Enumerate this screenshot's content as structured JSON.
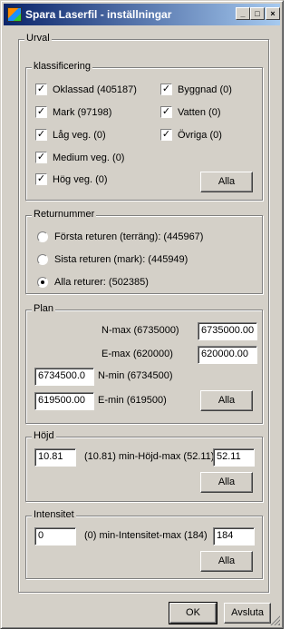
{
  "window": {
    "title": "Spara Laserfil - inställningar"
  },
  "caption_buttons": {
    "minimize": "_",
    "maximize": "□",
    "close": "×"
  },
  "urval": {
    "legend": "Urval",
    "klassificering": {
      "legend": "klassificering",
      "items": [
        {
          "label": "Oklassad (405187)",
          "checked": true
        },
        {
          "label": "Byggnad (0)",
          "checked": true
        },
        {
          "label": "Mark (97198)",
          "checked": true
        },
        {
          "label": "Vatten (0)",
          "checked": true
        },
        {
          "label": "Låg veg. (0)",
          "checked": true
        },
        {
          "label": "Övriga (0)",
          "checked": true
        },
        {
          "label": "Medium veg. (0)",
          "checked": true
        },
        {
          "label": "Hög veg. (0)",
          "checked": true
        }
      ],
      "all_button": "Alla"
    },
    "returnummer": {
      "legend": "Returnummer",
      "options": [
        {
          "label": "Första returen (terräng): (445967)",
          "selected": false
        },
        {
          "label": "Sista returen (mark): (445949)",
          "selected": false
        },
        {
          "label": "Alla returer: (502385)",
          "selected": true
        }
      ]
    },
    "plan": {
      "legend": "Plan",
      "nmax_label": "N-max (6735000)",
      "nmax_value": "6735000.00",
      "emax_label": "E-max (620000)",
      "emax_value": "620000.00",
      "nmin_value": "6734500.0",
      "nmin_label": "N-min (6734500)",
      "emin_value": "619500.00",
      "emin_label": "E-min (619500)",
      "all_button": "Alla"
    },
    "hojd": {
      "legend": "Höjd",
      "min_value": "10.81",
      "label": "(10.81) min-Höjd-max (52.11)",
      "max_value": "52.11",
      "all_button": "Alla"
    },
    "intensitet": {
      "legend": "Intensitet",
      "min_value": "0",
      "label": "(0) min-Intensitet-max (184)",
      "max_value": "184",
      "all_button": "Alla"
    }
  },
  "footer": {
    "ok_label": "OK",
    "cancel_label": "Avsluta"
  },
  "colors": {
    "face": "#d4d0c8",
    "title_start": "#0a246a",
    "title_end": "#a6caf0"
  }
}
